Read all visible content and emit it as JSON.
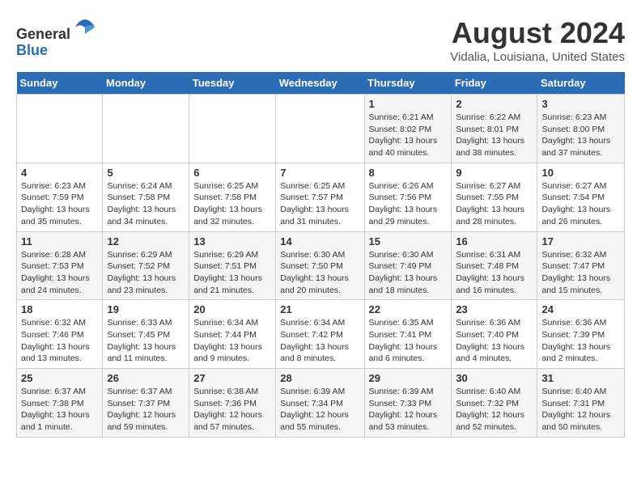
{
  "header": {
    "logo_line1": "General",
    "logo_line2": "Blue",
    "month_title": "August 2024",
    "location": "Vidalia, Louisiana, United States"
  },
  "weekdays": [
    "Sunday",
    "Monday",
    "Tuesday",
    "Wednesday",
    "Thursday",
    "Friday",
    "Saturday"
  ],
  "weeks": [
    [
      {
        "day": "",
        "info": ""
      },
      {
        "day": "",
        "info": ""
      },
      {
        "day": "",
        "info": ""
      },
      {
        "day": "",
        "info": ""
      },
      {
        "day": "1",
        "info": "Sunrise: 6:21 AM\nSunset: 8:02 PM\nDaylight: 13 hours\nand 40 minutes."
      },
      {
        "day": "2",
        "info": "Sunrise: 6:22 AM\nSunset: 8:01 PM\nDaylight: 13 hours\nand 38 minutes."
      },
      {
        "day": "3",
        "info": "Sunrise: 6:23 AM\nSunset: 8:00 PM\nDaylight: 13 hours\nand 37 minutes."
      }
    ],
    [
      {
        "day": "4",
        "info": "Sunrise: 6:23 AM\nSunset: 7:59 PM\nDaylight: 13 hours\nand 35 minutes."
      },
      {
        "day": "5",
        "info": "Sunrise: 6:24 AM\nSunset: 7:58 PM\nDaylight: 13 hours\nand 34 minutes."
      },
      {
        "day": "6",
        "info": "Sunrise: 6:25 AM\nSunset: 7:58 PM\nDaylight: 13 hours\nand 32 minutes."
      },
      {
        "day": "7",
        "info": "Sunrise: 6:25 AM\nSunset: 7:57 PM\nDaylight: 13 hours\nand 31 minutes."
      },
      {
        "day": "8",
        "info": "Sunrise: 6:26 AM\nSunset: 7:56 PM\nDaylight: 13 hours\nand 29 minutes."
      },
      {
        "day": "9",
        "info": "Sunrise: 6:27 AM\nSunset: 7:55 PM\nDaylight: 13 hours\nand 28 minutes."
      },
      {
        "day": "10",
        "info": "Sunrise: 6:27 AM\nSunset: 7:54 PM\nDaylight: 13 hours\nand 26 minutes."
      }
    ],
    [
      {
        "day": "11",
        "info": "Sunrise: 6:28 AM\nSunset: 7:53 PM\nDaylight: 13 hours\nand 24 minutes."
      },
      {
        "day": "12",
        "info": "Sunrise: 6:29 AM\nSunset: 7:52 PM\nDaylight: 13 hours\nand 23 minutes."
      },
      {
        "day": "13",
        "info": "Sunrise: 6:29 AM\nSunset: 7:51 PM\nDaylight: 13 hours\nand 21 minutes."
      },
      {
        "day": "14",
        "info": "Sunrise: 6:30 AM\nSunset: 7:50 PM\nDaylight: 13 hours\nand 20 minutes."
      },
      {
        "day": "15",
        "info": "Sunrise: 6:30 AM\nSunset: 7:49 PM\nDaylight: 13 hours\nand 18 minutes."
      },
      {
        "day": "16",
        "info": "Sunrise: 6:31 AM\nSunset: 7:48 PM\nDaylight: 13 hours\nand 16 minutes."
      },
      {
        "day": "17",
        "info": "Sunrise: 6:32 AM\nSunset: 7:47 PM\nDaylight: 13 hours\nand 15 minutes."
      }
    ],
    [
      {
        "day": "18",
        "info": "Sunrise: 6:32 AM\nSunset: 7:46 PM\nDaylight: 13 hours\nand 13 minutes."
      },
      {
        "day": "19",
        "info": "Sunrise: 6:33 AM\nSunset: 7:45 PM\nDaylight: 13 hours\nand 11 minutes."
      },
      {
        "day": "20",
        "info": "Sunrise: 6:34 AM\nSunset: 7:44 PM\nDaylight: 13 hours\nand 9 minutes."
      },
      {
        "day": "21",
        "info": "Sunrise: 6:34 AM\nSunset: 7:42 PM\nDaylight: 13 hours\nand 8 minutes."
      },
      {
        "day": "22",
        "info": "Sunrise: 6:35 AM\nSunset: 7:41 PM\nDaylight: 13 hours\nand 6 minutes."
      },
      {
        "day": "23",
        "info": "Sunrise: 6:36 AM\nSunset: 7:40 PM\nDaylight: 13 hours\nand 4 minutes."
      },
      {
        "day": "24",
        "info": "Sunrise: 6:36 AM\nSunset: 7:39 PM\nDaylight: 13 hours\nand 2 minutes."
      }
    ],
    [
      {
        "day": "25",
        "info": "Sunrise: 6:37 AM\nSunset: 7:38 PM\nDaylight: 13 hours\nand 1 minute."
      },
      {
        "day": "26",
        "info": "Sunrise: 6:37 AM\nSunset: 7:37 PM\nDaylight: 12 hours\nand 59 minutes."
      },
      {
        "day": "27",
        "info": "Sunrise: 6:38 AM\nSunset: 7:36 PM\nDaylight: 12 hours\nand 57 minutes."
      },
      {
        "day": "28",
        "info": "Sunrise: 6:39 AM\nSunset: 7:34 PM\nDaylight: 12 hours\nand 55 minutes."
      },
      {
        "day": "29",
        "info": "Sunrise: 6:39 AM\nSunset: 7:33 PM\nDaylight: 12 hours\nand 53 minutes."
      },
      {
        "day": "30",
        "info": "Sunrise: 6:40 AM\nSunset: 7:32 PM\nDaylight: 12 hours\nand 52 minutes."
      },
      {
        "day": "31",
        "info": "Sunrise: 6:40 AM\nSunset: 7:31 PM\nDaylight: 12 hours\nand 50 minutes."
      }
    ]
  ]
}
